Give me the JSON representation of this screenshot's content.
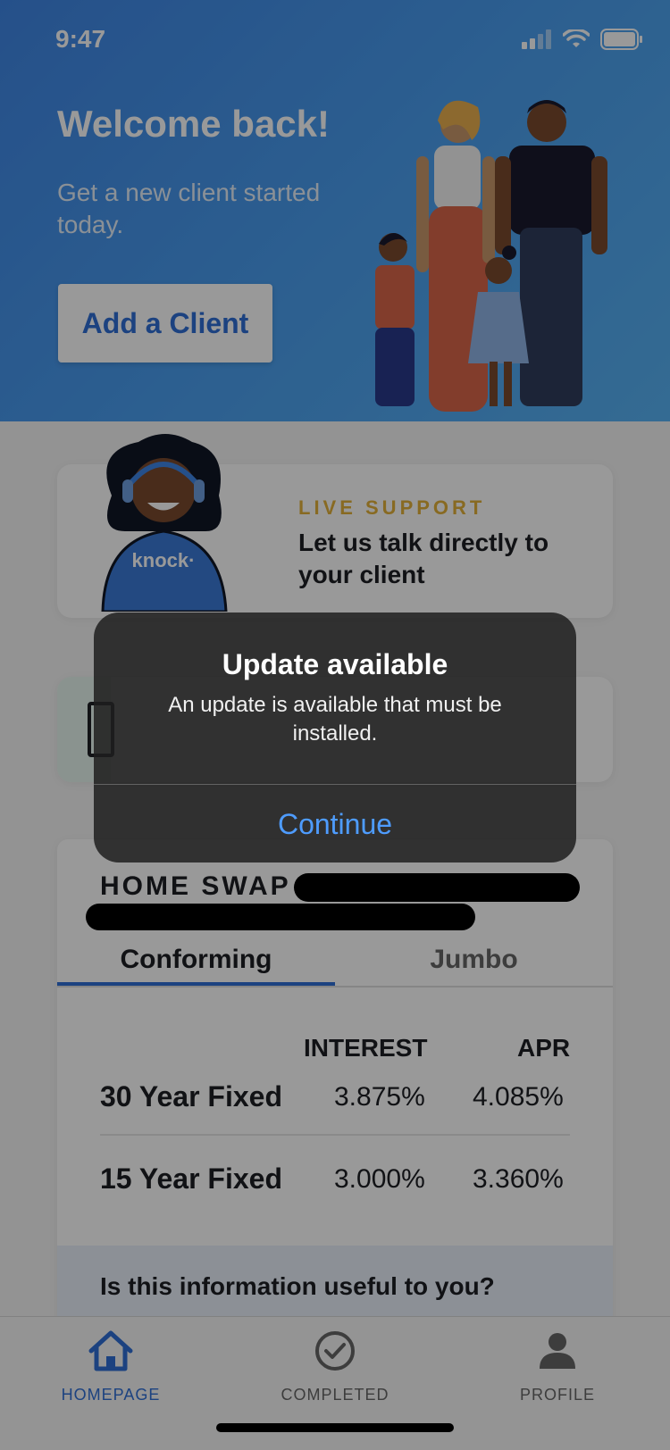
{
  "status": {
    "time": "9:47"
  },
  "hero": {
    "title": "Welcome back!",
    "subtitle": "Get a new client started today.",
    "add_client_label": "Add a Client"
  },
  "support": {
    "label": "LIVE SUPPORT",
    "text": "Let us talk directly to your client",
    "agent_shirt_text": "knock·"
  },
  "rates": {
    "title": "HOME SWAP",
    "tabs": [
      {
        "label": "Conforming",
        "active": true
      },
      {
        "label": "Jumbo",
        "active": false
      }
    ],
    "headers": {
      "interest": "INTEREST",
      "apr": "APR"
    },
    "rows": [
      {
        "label": "30 Year Fixed",
        "interest": "3.875%",
        "apr": "4.085%"
      },
      {
        "label": "15 Year Fixed",
        "interest": "3.000%",
        "apr": "3.360%"
      }
    ],
    "feedback": "Is this information useful to you?"
  },
  "tabbar": {
    "items": [
      {
        "label": "HOMEPAGE",
        "icon": "home-icon",
        "active": true
      },
      {
        "label": "COMPLETED",
        "icon": "check-circle-icon",
        "active": false
      },
      {
        "label": "PROFILE",
        "icon": "person-icon",
        "active": false
      }
    ]
  },
  "alert": {
    "title": "Update available",
    "message": "An update is available that must be installed.",
    "button": "Continue"
  },
  "colors": {
    "accent": "#2f6fd6",
    "gold": "#e3b13a",
    "alert_button": "#4e9cff"
  }
}
